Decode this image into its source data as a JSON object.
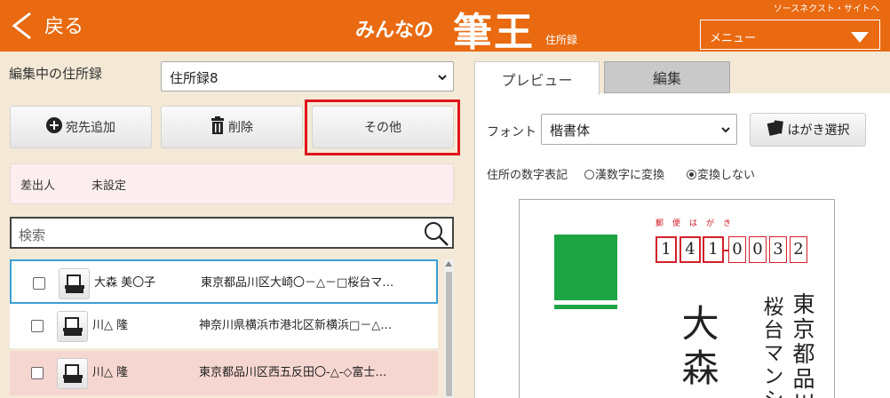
{
  "header": {
    "back_label": "戻る",
    "logo_prefix": "みんなの",
    "logo_main": "筆王",
    "logo_sub": "住所録",
    "source_link": "ソースネクスト・サイトへ",
    "menu_label": "メニュー"
  },
  "address_book": {
    "label": "編集中の住所録",
    "selected": "住所録8"
  },
  "toolbar": {
    "add_label": "宛先追加",
    "delete_label": "削除",
    "other_label": "その他"
  },
  "sender": {
    "label": "差出人",
    "value": "未設定"
  },
  "search": {
    "placeholder": "検索"
  },
  "contacts": [
    {
      "name": "大森 美〇子",
      "address": "東京都品川区大崎〇－△－□桜台マ…"
    },
    {
      "name": "川△ 隆",
      "address": "神奈川県横浜市港北区新横浜□－△…"
    },
    {
      "name": "川△ 隆",
      "address": "東京都品川区西五反田〇-△-◇富士…"
    }
  ],
  "preview": {
    "tab_preview": "プレビュー",
    "tab_edit": "編集",
    "font_label": "フォント",
    "font_value": "楷書体",
    "card_button": "はがき選択",
    "numeral_label": "住所の数字表記",
    "option_kanji": "漢数字に変換",
    "option_none": "変換しない",
    "selected_option": "none"
  },
  "postcard": {
    "header_label": "郵便はがき",
    "zip": [
      "1",
      "4",
      "1",
      "0",
      "0",
      "3",
      "2"
    ],
    "address_line1": "東京都品川",
    "address_line2": "桜台マンシ",
    "recipient": "大森"
  },
  "colors": {
    "header_orange": "#e96a10",
    "highlight_red": "#e0141e",
    "stamp_green": "#1da443",
    "postal_red": "#d2202b",
    "selected_row_blue": "#3c9fd6"
  }
}
